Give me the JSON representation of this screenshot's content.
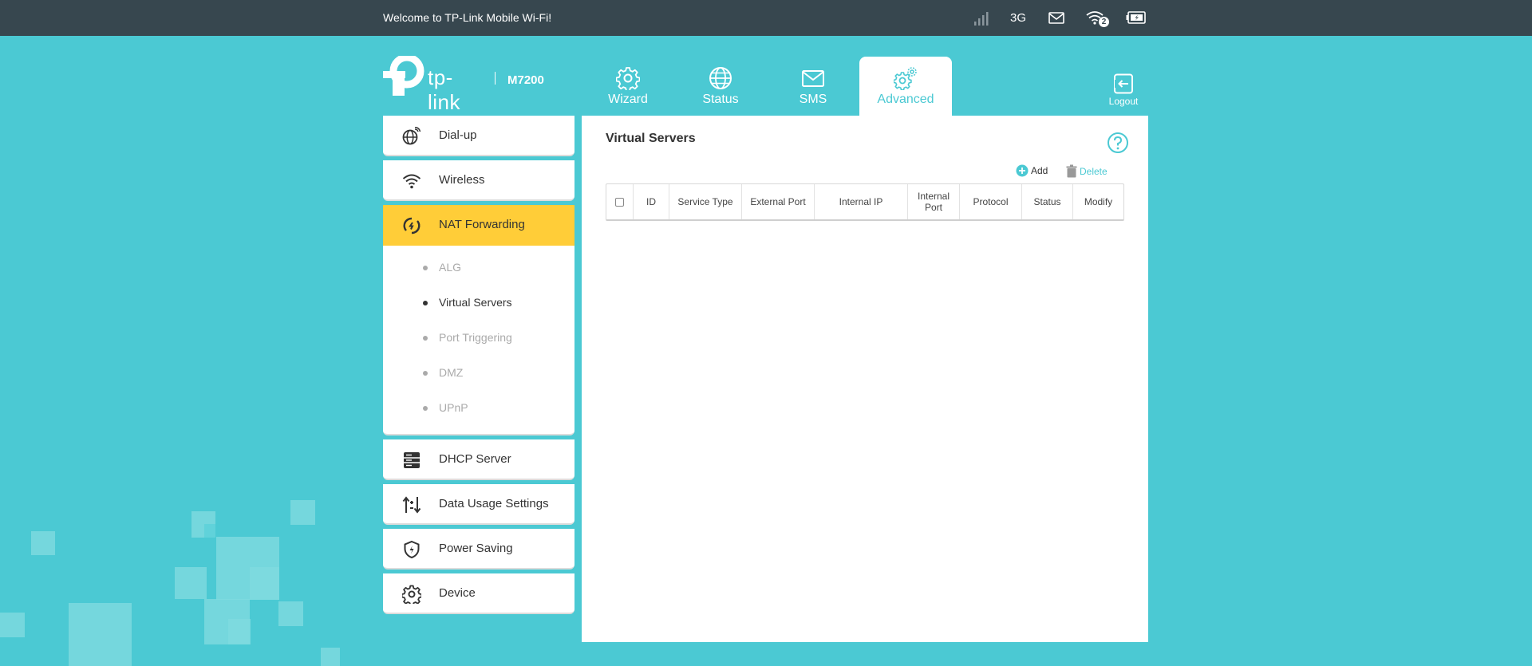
{
  "topbar": {
    "welcome": "Welcome to TP-Link Mobile Wi-Fi!",
    "network": "3G",
    "wifi_clients": "2"
  },
  "header": {
    "brand": "tp-link",
    "model": "M7200"
  },
  "nav": {
    "tabs": [
      {
        "label": "Wizard"
      },
      {
        "label": "Status"
      },
      {
        "label": "SMS"
      },
      {
        "label": "Advanced"
      }
    ],
    "active": "Advanced",
    "logout": "Logout"
  },
  "sidebar": {
    "items": [
      {
        "label": "Dial-up"
      },
      {
        "label": "Wireless"
      },
      {
        "label": "NAT Forwarding"
      },
      {
        "label": "DHCP Server"
      },
      {
        "label": "Data Usage Settings"
      },
      {
        "label": "Power Saving"
      },
      {
        "label": "Device"
      }
    ],
    "active": "NAT Forwarding",
    "submenu": [
      {
        "label": "ALG"
      },
      {
        "label": "Virtual Servers"
      },
      {
        "label": "Port Triggering"
      },
      {
        "label": "DMZ"
      },
      {
        "label": "UPnP"
      }
    ],
    "active_sub": "Virtual Servers"
  },
  "main": {
    "title": "Virtual Servers",
    "add_label": "Add",
    "delete_label": "Delete",
    "columns": [
      "ID",
      "Service Type",
      "External Port",
      "Internal IP",
      "Internal Port",
      "Protocol",
      "Status",
      "Modify"
    ]
  },
  "colors": {
    "accent": "#4bc9d3",
    "topbar": "#37474f",
    "active_menu": "#ffcd38"
  }
}
